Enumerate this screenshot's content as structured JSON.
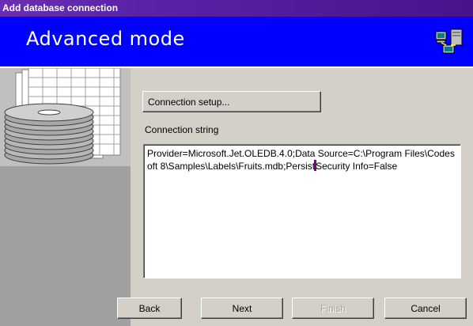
{
  "window": {
    "title": "Add database connection"
  },
  "banner": {
    "title": "Advanced mode",
    "icon": "network-computers-icon"
  },
  "sidebar": {
    "graphic": "database-disks-icon"
  },
  "main": {
    "connection_setup_label": "Connection setup...",
    "connection_string_label": "Connection string",
    "connection_string_before_caret": "Provider=Microsoft.Jet.OLEDB.4.0;Data Source=C:\\Program Files\\Codesoft 8\\Samples\\Labels\\Fruits.mdb;Persist",
    "connection_string_after_caret": "Security Info=False"
  },
  "footer": {
    "back_label": "Back",
    "next_label": "Next",
    "finish_label": "Finish",
    "cancel_label": "Cancel"
  },
  "colors": {
    "banner": "#0000ff",
    "titlebar": "#5a22a8",
    "caret": "#800080"
  }
}
